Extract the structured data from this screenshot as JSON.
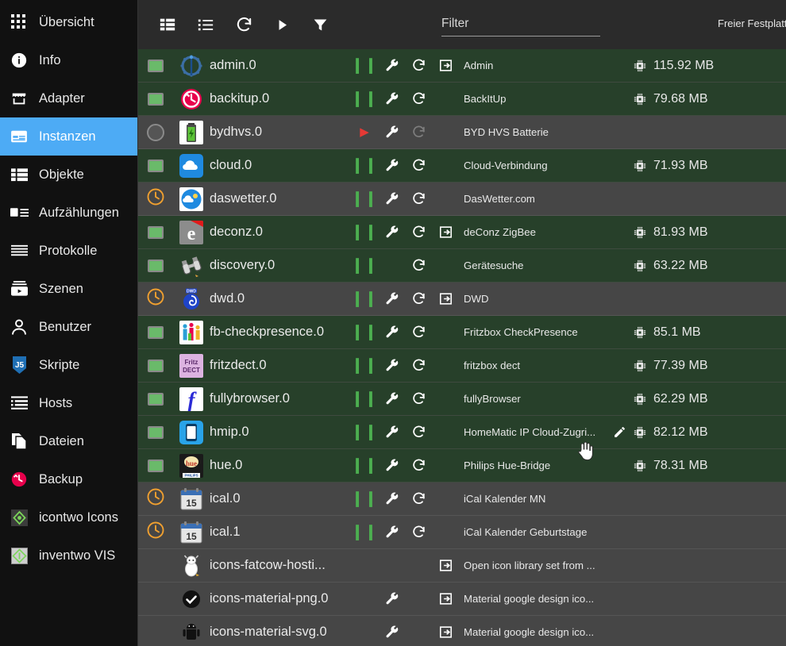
{
  "sidebar": {
    "items": [
      {
        "label": "Übersicht",
        "icon": "grid-icon",
        "selected": false
      },
      {
        "label": "Info",
        "icon": "info-icon",
        "selected": false
      },
      {
        "label": "Adapter",
        "icon": "store-icon",
        "selected": false
      },
      {
        "label": "Instanzen",
        "icon": "instances-icon",
        "selected": true
      },
      {
        "label": "Objekte",
        "icon": "list-icon",
        "selected": false
      },
      {
        "label": "Aufzählungen",
        "icon": "enum-icon",
        "selected": false
      },
      {
        "label": "Protokolle",
        "icon": "logs-icon",
        "selected": false
      },
      {
        "label": "Szenen",
        "icon": "scenes-icon",
        "selected": false
      },
      {
        "label": "Benutzer",
        "icon": "user-icon",
        "selected": false
      },
      {
        "label": "Skripte",
        "icon": "js-icon",
        "selected": false
      },
      {
        "label": "Hosts",
        "icon": "hosts-icon",
        "selected": false
      },
      {
        "label": "Dateien",
        "icon": "files-icon",
        "selected": false
      },
      {
        "label": "Backup",
        "icon": "backup-icon",
        "selected": false
      },
      {
        "label": "icontwo Icons",
        "icon": "icontwo-icon",
        "selected": false
      },
      {
        "label": "inventwo VIS",
        "icon": "inventwo-icon",
        "selected": false
      }
    ]
  },
  "toolbar": {
    "buttons": [
      {
        "name": "expand-all-icon",
        "title": "Alle ausklappen"
      },
      {
        "name": "collapse-all-icon",
        "title": "Alle einklappen"
      },
      {
        "name": "refresh-icon",
        "title": "Aktualisieren"
      },
      {
        "name": "play-icon",
        "title": "Starten"
      },
      {
        "name": "filter-icon",
        "title": "Filter"
      }
    ],
    "filter": {
      "value": "",
      "placeholder": "Filter"
    },
    "disk_label": "Freier Festplatt"
  },
  "colors": {
    "accent": "#4dabf5",
    "row_running": "#27402a",
    "row_stopped": "#464646",
    "status_green": "#6aba6a",
    "status_orange": "#f0a030",
    "pause_green": "#4caf50",
    "play_red": "#e53935"
  },
  "table": {
    "rows": [
      {
        "id": "admin.0",
        "title": "Admin",
        "memory": "115.92 MB",
        "state": "run",
        "status": "square-green",
        "pause": true,
        "wrench": true,
        "restart": "active",
        "link": true,
        "pencil": false,
        "icon": "admin-gear-icon"
      },
      {
        "id": "backitup.0",
        "title": "BackItUp",
        "memory": "79.68 MB",
        "state": "run",
        "status": "square-green",
        "pause": true,
        "wrench": true,
        "restart": "active",
        "link": false,
        "pencil": false,
        "icon": "backitup-clock-icon"
      },
      {
        "id": "bydhvs.0",
        "title": "BYD HVS Batterie",
        "memory": "",
        "state": "stop",
        "status": "circle-gray",
        "pause": false,
        "wrench": true,
        "restart": "dim",
        "link": false,
        "pencil": false,
        "icon": "battery-icon"
      },
      {
        "id": "cloud.0",
        "title": "Cloud-Verbindung",
        "memory": "71.93 MB",
        "state": "run",
        "status": "square-green",
        "pause": true,
        "wrench": true,
        "restart": "active",
        "link": false,
        "pencil": false,
        "icon": "cloud-icon"
      },
      {
        "id": "daswetter.0",
        "title": "DasWetter.com",
        "memory": "",
        "state": "sched",
        "status": "clock-orange",
        "pause": true,
        "wrench": true,
        "restart": "active",
        "link": false,
        "pencil": false,
        "icon": "weather-icon"
      },
      {
        "id": "deconz.0",
        "title": "deConz ZigBee",
        "memory": "81.93 MB",
        "state": "run",
        "status": "square-green",
        "pause": true,
        "wrench": true,
        "restart": "active",
        "link": true,
        "pencil": false,
        "icon": "deconz-icon"
      },
      {
        "id": "discovery.0",
        "title": "Gerätesuche",
        "memory": "63.22 MB",
        "state": "run",
        "status": "square-green",
        "pause": true,
        "wrench": false,
        "restart": "active",
        "link": false,
        "pencil": false,
        "icon": "binoculars-icon"
      },
      {
        "id": "dwd.0",
        "title": "DWD",
        "memory": "",
        "state": "sched",
        "status": "clock-orange",
        "pause": true,
        "wrench": true,
        "restart": "active",
        "link": true,
        "pencil": false,
        "icon": "dwd-icon"
      },
      {
        "id": "fb-checkpresence.0",
        "title": "Fritzbox CheckPresence",
        "memory": "85.1 MB",
        "state": "run",
        "status": "square-green",
        "pause": true,
        "wrench": true,
        "restart": "active",
        "link": false,
        "pencil": false,
        "icon": "presence-icon"
      },
      {
        "id": "fritzdect.0",
        "title": "fritzbox dect",
        "memory": "77.39 MB",
        "state": "run",
        "status": "square-green",
        "pause": true,
        "wrench": true,
        "restart": "active",
        "link": false,
        "pencil": false,
        "icon": "fritzdect-icon"
      },
      {
        "id": "fullybrowser.0",
        "title": "fullyBrowser",
        "memory": "62.29 MB",
        "state": "run",
        "status": "square-green",
        "pause": true,
        "wrench": true,
        "restart": "active",
        "link": false,
        "pencil": false,
        "icon": "fully-icon"
      },
      {
        "id": "hmip.0",
        "title": "HomeMatic IP Cloud-Zugri...",
        "memory": "82.12 MB",
        "state": "run",
        "status": "square-green",
        "pause": true,
        "wrench": true,
        "restart": "active",
        "link": false,
        "pencil": true,
        "icon": "hmip-icon"
      },
      {
        "id": "hue.0",
        "title": "Philips Hue-Bridge",
        "memory": "78.31 MB",
        "state": "run",
        "status": "square-green",
        "pause": true,
        "wrench": true,
        "restart": "active",
        "link": false,
        "pencil": false,
        "icon": "hue-icon"
      },
      {
        "id": "ical.0",
        "title": "iCal Kalender MN",
        "memory": "",
        "state": "sched",
        "status": "clock-orange",
        "pause": true,
        "wrench": true,
        "restart": "active",
        "link": false,
        "pencil": false,
        "icon": "calendar-icon"
      },
      {
        "id": "ical.1",
        "title": "iCal Kalender Geburtstage",
        "memory": "",
        "state": "sched",
        "status": "clock-orange",
        "pause": true,
        "wrench": true,
        "restart": "active",
        "link": false,
        "pencil": false,
        "icon": "calendar-icon"
      },
      {
        "id": "icons-fatcow-hosti...",
        "title": "Open icon library set from ...",
        "memory": "",
        "state": "none",
        "status": "none",
        "pause": false,
        "wrench": false,
        "restart": "none",
        "link": true,
        "pencil": false,
        "icon": "fatcow-icon"
      },
      {
        "id": "icons-material-png.0",
        "title": "Material google design ico...",
        "memory": "",
        "state": "none",
        "status": "none",
        "pause": false,
        "wrench": true,
        "restart": "none",
        "link": true,
        "pencil": false,
        "icon": "material-check-icon"
      },
      {
        "id": "icons-material-svg.0",
        "title": "Material google design ico...",
        "memory": "",
        "state": "none",
        "status": "none",
        "pause": false,
        "wrench": true,
        "restart": "none",
        "link": true,
        "pencil": false,
        "icon": "android-icon"
      }
    ]
  }
}
